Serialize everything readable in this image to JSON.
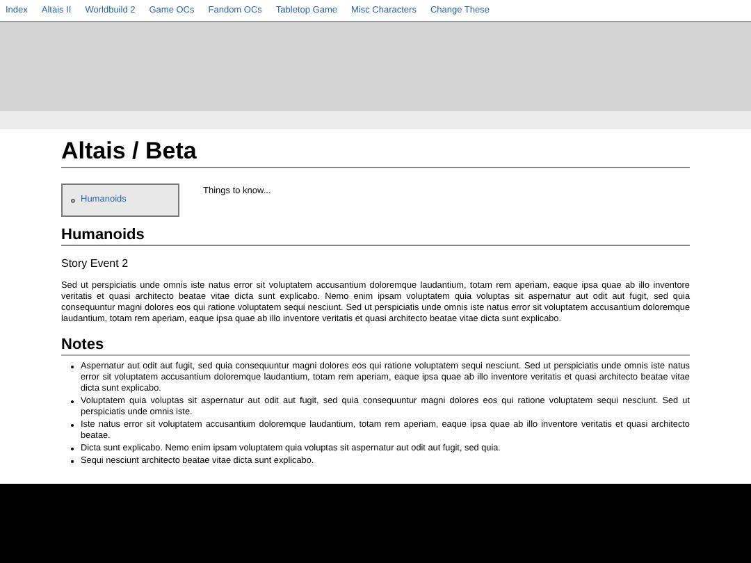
{
  "nav": [
    "Index",
    "Altais II",
    "Worldbuild 2",
    "Game OCs",
    "Fandom OCs",
    "Tabletop Game",
    "Misc Characters",
    "Change These"
  ],
  "title": "Altais / Beta",
  "toc": [
    "Humanoids"
  ],
  "intro": "Things to know...",
  "sections": [
    {
      "heading": "Humanoids",
      "subheading": "Story Event 2",
      "paragraph": "Sed ut perspiciatis unde omnis iste natus error sit voluptatem accusantium doloremque laudantium, totam rem aperiam, eaque ipsa quae ab illo inventore veritatis et quasi architecto beatae vitae dicta sunt explicabo. Nemo enim ipsam voluptatem quia voluptas sit aspernatur aut odit aut fugit, sed quia consequuntur magni dolores eos qui ratione voluptatem sequi nesciunt. Sed ut perspiciatis unde omnis iste natus error sit voluptatem accusantium doloremque laudantium, totam rem aperiam, eaque ipsa quae ab illo inventore veritatis et quasi architecto beatae vitae dicta sunt explicabo."
    }
  ],
  "notes": {
    "heading": "Notes",
    "items": [
      "Aspernatur aut odit aut fugit, sed quia consequuntur magni dolores eos qui ratione voluptatem sequi nesciunt. Sed ut perspiciatis unde omnis iste natus error sit voluptatem accusantium doloremque laudantium, totam rem aperiam, eaque ipsa quae ab illo inventore veritatis et quasi architecto beatae vitae dicta sunt explicabo.",
      "Voluptatem quia voluptas sit aspernatur aut odit aut fugit, sed quia consequuntur magni dolores eos qui ratione voluptatem sequi nesciunt. Sed ut perspiciatis unde omnis iste.",
      "Iste natus error sit voluptatem accusantium doloremque laudantium, totam rem aperiam, eaque ipsa quae ab illo inventore veritatis et quasi architecto beatae.",
      "Dicta sunt explicabo. Nemo enim ipsam voluptatem quia voluptas sit aspernatur aut odit aut fugit, sed quia.",
      "Sequi nesciunt architecto beatae vitae dicta sunt explicabo."
    ]
  }
}
